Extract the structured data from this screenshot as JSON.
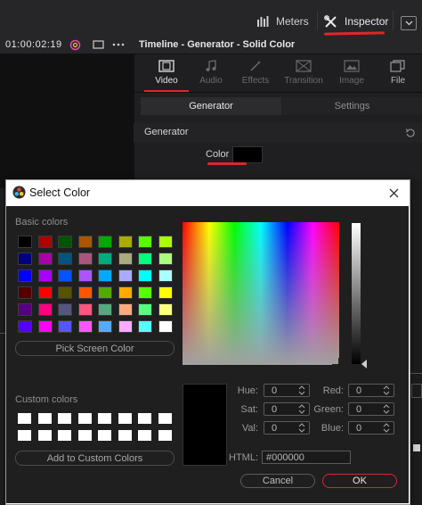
{
  "topbar": {
    "meters_label": "Meters",
    "inspector_label": "Inspector"
  },
  "viewer": {
    "timecode": "01:00:02:19"
  },
  "inspector": {
    "title": "Timeline - Generator - Solid Color",
    "tabs": [
      {
        "label": "Video",
        "icon": "filmstrip-icon",
        "active": true
      },
      {
        "label": "Audio",
        "icon": "music-note-icon",
        "active": false
      },
      {
        "label": "Effects",
        "icon": "magic-wand-icon",
        "active": false
      },
      {
        "label": "Transition",
        "icon": "transition-icon",
        "active": false
      },
      {
        "label": "Image",
        "icon": "image-icon",
        "active": false
      },
      {
        "label": "File",
        "icon": "file-icon",
        "active": false
      }
    ],
    "subtabs": {
      "generator": "Generator",
      "settings": "Settings"
    },
    "section_title": "Generator",
    "color_label": "Color",
    "color_value": "#000000"
  },
  "dialog": {
    "title": "Select Color",
    "basic_colors_label": "Basic colors",
    "basic_colors": [
      "#000000",
      "#ad0000",
      "#005500",
      "#aa5500",
      "#00aa00",
      "#aaaa00",
      "#55ff00",
      "#aaff00",
      "#00007f",
      "#aa00aa",
      "#00557f",
      "#aa557f",
      "#00aa7f",
      "#aaaa7f",
      "#00ff7f",
      "#aaff7f",
      "#0000ff",
      "#aa00ff",
      "#0055ff",
      "#aa55ff",
      "#00aaff",
      "#aaaaff",
      "#00ffff",
      "#aaffff",
      "#550000",
      "#ff0000",
      "#555500",
      "#ff5500",
      "#55aa00",
      "#ffaa00",
      "#55ff00",
      "#ffff00",
      "#55007f",
      "#ff007f",
      "#55557f",
      "#ff557f",
      "#55aa7f",
      "#ffaa7f",
      "#55ff7f",
      "#ffff7f",
      "#5500ff",
      "#ff00ff",
      "#5555ff",
      "#ff55ff",
      "#55aaff",
      "#ffaaff",
      "#55ffff",
      "#ffffff"
    ],
    "pick_screen_label": "Pick Screen Color",
    "custom_colors_label": "Custom colors",
    "custom_colors": [
      "#ffffff",
      "#ffffff",
      "#ffffff",
      "#ffffff",
      "#ffffff",
      "#ffffff",
      "#ffffff",
      "#ffffff",
      "#ffffff",
      "#ffffff",
      "#ffffff",
      "#ffffff",
      "#ffffff",
      "#ffffff",
      "#ffffff",
      "#ffffff"
    ],
    "add_custom_label": "Add to Custom Colors",
    "fields": {
      "hue": {
        "label": "Hue:",
        "value": "0"
      },
      "sat": {
        "label": "Sat:",
        "value": "0"
      },
      "val": {
        "label": "Val:",
        "value": "0"
      },
      "red": {
        "label": "Red:",
        "value": "0"
      },
      "green": {
        "label": "Green:",
        "value": "0"
      },
      "blue": {
        "label": "Blue:",
        "value": "0"
      }
    },
    "html_label": "HTML:",
    "html_value": "#000000",
    "cancel_label": "Cancel",
    "ok_label": "OK",
    "current_color": "#000000"
  }
}
